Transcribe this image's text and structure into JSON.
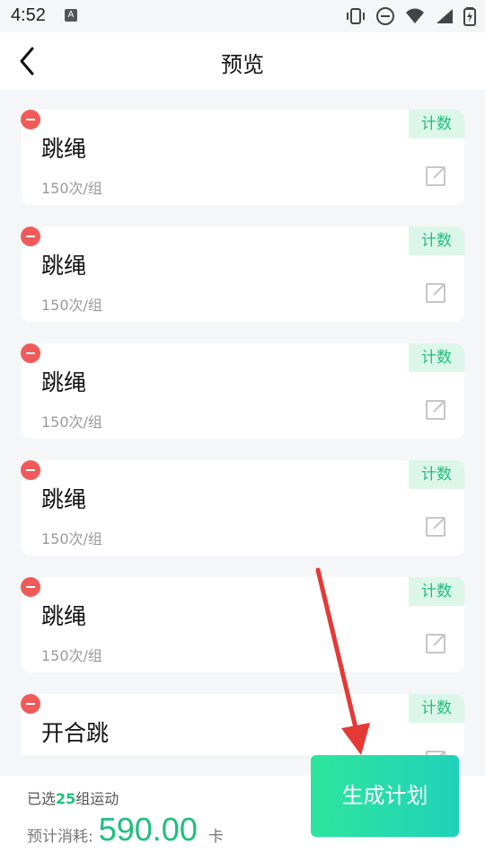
{
  "status": {
    "time": "4:52",
    "notif": "A"
  },
  "header": {
    "title": "预览"
  },
  "items": [
    {
      "name": "跳绳",
      "meta": "150次/组",
      "tag": "计数"
    },
    {
      "name": "跳绳",
      "meta": "150次/组",
      "tag": "计数"
    },
    {
      "name": "跳绳",
      "meta": "150次/组",
      "tag": "计数"
    },
    {
      "name": "跳绳",
      "meta": "150次/组",
      "tag": "计数"
    },
    {
      "name": "跳绳",
      "meta": "150次/组",
      "tag": "计数"
    },
    {
      "name": "开合跳",
      "tag": "计数"
    }
  ],
  "bottom": {
    "selected_prefix": "已选",
    "selected_count": "25",
    "selected_suffix": "组运动",
    "estimate_label": "预计消耗:",
    "estimate_value": "590.00",
    "estimate_unit": "卡",
    "generate_label": "生成计划"
  },
  "colors": {
    "accent": "#1fbf7d",
    "danger": "#f25a5a",
    "arrow": "#e53935"
  }
}
